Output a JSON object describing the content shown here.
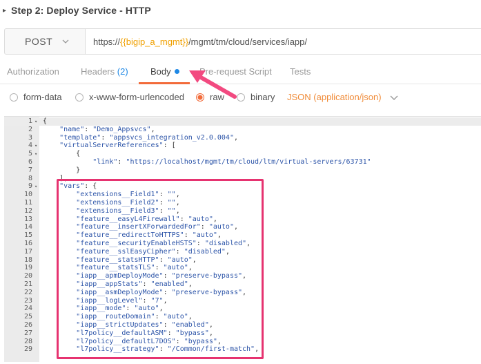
{
  "header": {
    "title": "Step 2: Deploy Service - HTTP"
  },
  "request": {
    "method": "POST",
    "url_prefix": "https://",
    "url_variable": "{{bigip_a_mgmt}}",
    "url_suffix": "/mgmt/tm/cloud/services/iapp/"
  },
  "tabs": [
    {
      "label": "Authorization"
    },
    {
      "label": "Headers",
      "count": "(2)"
    },
    {
      "label": "Body"
    },
    {
      "label": "Pre-request Script"
    },
    {
      "label": "Tests"
    }
  ],
  "body_modes": [
    {
      "label": "form-data",
      "selected": false
    },
    {
      "label": "x-www-form-urlencoded",
      "selected": false
    },
    {
      "label": "raw",
      "selected": true
    },
    {
      "label": "binary",
      "selected": false
    }
  ],
  "content_type": "JSON (application/json)",
  "editor": {
    "lines": [
      {
        "n": "1",
        "fold": "▾",
        "text": "{"
      },
      {
        "n": "2",
        "fold": "",
        "text": "    \"name\": \"Demo_Appsvcs\","
      },
      {
        "n": "3",
        "fold": "",
        "text": "    \"template\": \"appsvcs_integration_v2.0.004\","
      },
      {
        "n": "4",
        "fold": "▾",
        "text": "    \"virtualServerReferences\": ["
      },
      {
        "n": "5",
        "fold": "▾",
        "text": "        {"
      },
      {
        "n": "6",
        "fold": "",
        "text": "            \"link\": \"https://localhost/mgmt/tm/cloud/ltm/virtual-servers/63731\""
      },
      {
        "n": "7",
        "fold": "",
        "text": "        }"
      },
      {
        "n": "8",
        "fold": "",
        "text": "    ],"
      },
      {
        "n": "9",
        "fold": "▾",
        "text": "    \"vars\": {"
      },
      {
        "n": "10",
        "fold": "",
        "text": "        \"extensions__Field1\": \"\","
      },
      {
        "n": "11",
        "fold": "",
        "text": "        \"extensions__Field2\": \"\","
      },
      {
        "n": "12",
        "fold": "",
        "text": "        \"extensions__Field3\": \"\","
      },
      {
        "n": "13",
        "fold": "",
        "text": "        \"feature__easyL4Firewall\": \"auto\","
      },
      {
        "n": "14",
        "fold": "",
        "text": "        \"feature__insertXForwardedFor\": \"auto\","
      },
      {
        "n": "15",
        "fold": "",
        "text": "        \"feature__redirectToHTTPS\": \"auto\","
      },
      {
        "n": "16",
        "fold": "",
        "text": "        \"feature__securityEnableHSTS\": \"disabled\","
      },
      {
        "n": "17",
        "fold": "",
        "text": "        \"feature__sslEasyCipher\": \"disabled\","
      },
      {
        "n": "18",
        "fold": "",
        "text": "        \"feature__statsHTTP\": \"auto\","
      },
      {
        "n": "19",
        "fold": "",
        "text": "        \"feature__statsTLS\": \"auto\","
      },
      {
        "n": "20",
        "fold": "",
        "text": "        \"iapp__apmDeployMode\": \"preserve-bypass\","
      },
      {
        "n": "21",
        "fold": "",
        "text": "        \"iapp__appStats\": \"enabled\","
      },
      {
        "n": "22",
        "fold": "",
        "text": "        \"iapp__asmDeployMode\": \"preserve-bypass\","
      },
      {
        "n": "23",
        "fold": "",
        "text": "        \"iapp__logLevel\": \"7\","
      },
      {
        "n": "24",
        "fold": "",
        "text": "        \"iapp__mode\": \"auto\","
      },
      {
        "n": "25",
        "fold": "",
        "text": "        \"iapp__routeDomain\": \"auto\","
      },
      {
        "n": "26",
        "fold": "",
        "text": "        \"iapp__strictUpdates\": \"enabled\","
      },
      {
        "n": "27",
        "fold": "",
        "text": "        \"l7policy__defaultASM\": \"bypass\","
      },
      {
        "n": "28",
        "fold": "",
        "text": "        \"l7policy__defaultL7DOS\": \"bypass\","
      },
      {
        "n": "29",
        "fold": "",
        "text": "        \"l7policy__strategy\": \"/Common/first-match\","
      }
    ]
  },
  "colors": {
    "accent": "#f26b3a",
    "annotation": "#e63370",
    "link_blue": "#1e88e5",
    "variable": "#f0a000"
  }
}
